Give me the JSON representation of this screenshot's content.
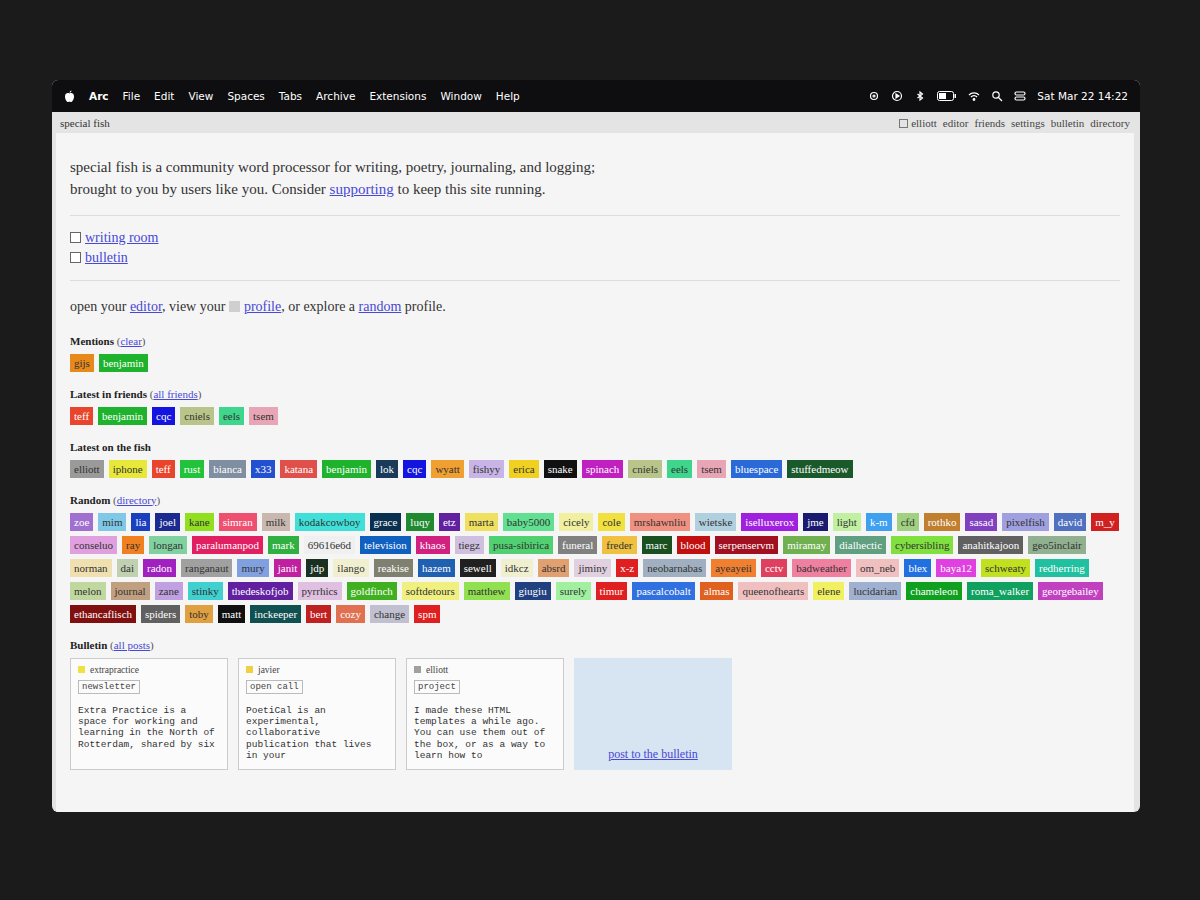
{
  "menubar": {
    "app": "Arc",
    "items": [
      "File",
      "Edit",
      "View",
      "Spaces",
      "Tabs",
      "Archive",
      "Extensions",
      "Window",
      "Help"
    ],
    "clock": "Sat Mar 22 14:22"
  },
  "tab": {
    "title": "special fish"
  },
  "nav": {
    "items": [
      "elliott",
      "editor",
      "friends",
      "settings",
      "bulletin",
      "directory"
    ]
  },
  "intro": {
    "line1": "special fish is a community word processor for writing, poetry, journaling, and logging;",
    "line2_before": "brought to you by users like you. Consider ",
    "line2_link": "supporting",
    "line2_after": " to keep this site running."
  },
  "rooms": [
    {
      "label": "writing room"
    },
    {
      "label": "bulletin"
    }
  ],
  "open_line": [
    {
      "text": "open your ",
      "link": false
    },
    {
      "text": "editor",
      "link": true
    },
    {
      "text": ", view your ",
      "link": false
    },
    {
      "text": "profile",
      "link": true,
      "box": true
    },
    {
      "text": ", or explore a ",
      "link": false
    },
    {
      "text": "random",
      "link": true
    },
    {
      "text": " profile.",
      "link": false
    }
  ],
  "brackets": [
    "(",
    ")"
  ],
  "sections": [
    {
      "title": "Mentions",
      "action": "clear",
      "tags": [
        {
          "name": "gijs",
          "color": "#e8891c"
        },
        {
          "name": "benjamin",
          "color": "#1fb32d"
        }
      ]
    },
    {
      "title": "Latest in friends",
      "action": "all friends",
      "tags": [
        {
          "name": "teff",
          "color": "#e8452c"
        },
        {
          "name": "benjamin",
          "color": "#1fb32d"
        },
        {
          "name": "cqc",
          "color": "#1414e0"
        },
        {
          "name": "cniels",
          "color": "#b9c48a"
        },
        {
          "name": "eels",
          "color": "#3dd68c"
        },
        {
          "name": "tsem",
          "color": "#e8a5b5"
        }
      ]
    },
    {
      "title": "Latest on the fish",
      "action": "",
      "tags": [
        {
          "name": "elliott",
          "color": "#9a9a9a"
        },
        {
          "name": "iphone",
          "color": "#e8e83a"
        },
        {
          "name": "teff",
          "color": "#e8452c"
        },
        {
          "name": "rust",
          "color": "#22c23a"
        },
        {
          "name": "bianca",
          "color": "#7f8ea0"
        },
        {
          "name": "x33",
          "color": "#2250d0"
        },
        {
          "name": "katana",
          "color": "#e0504a"
        },
        {
          "name": "benjamin",
          "color": "#1fb32d"
        },
        {
          "name": "lok",
          "color": "#1a3a5a"
        },
        {
          "name": "cqc",
          "color": "#1414e0"
        },
        {
          "name": "wyatt",
          "color": "#f0a030"
        },
        {
          "name": "fishyy",
          "color": "#c8b4e6"
        },
        {
          "name": "erica",
          "color": "#f0d020"
        },
        {
          "name": "snake",
          "color": "#111111"
        },
        {
          "name": "spinach",
          "color": "#c020c0"
        },
        {
          "name": "cniels",
          "color": "#b9c48a"
        },
        {
          "name": "eels",
          "color": "#3dd68c"
        },
        {
          "name": "tsem",
          "color": "#e8a5b5"
        },
        {
          "name": "bluespace",
          "color": "#2a6ad8"
        },
        {
          "name": "stuffedmeow",
          "color": "#1a5a2a"
        }
      ]
    },
    {
      "title": "Random",
      "action": "directory",
      "tags": [
        {
          "name": "zoe",
          "color": "#a070d0"
        },
        {
          "name": "mim",
          "color": "#80c8e8"
        },
        {
          "name": "lia",
          "color": "#1a40c0"
        },
        {
          "name": "joel",
          "color": "#1a2a90"
        },
        {
          "name": "kane",
          "color": "#90e020"
        },
        {
          "name": "simran",
          "color": "#f05070"
        },
        {
          "name": "milk",
          "color": "#c8b8b0"
        },
        {
          "name": "kodakcowboy",
          "color": "#40e0d8"
        },
        {
          "name": "grace",
          "color": "#0a3050"
        },
        {
          "name": "luqy",
          "color": "#208a30"
        },
        {
          "name": "etz",
          "color": "#6020a0"
        },
        {
          "name": "marta",
          "color": "#f0e060"
        },
        {
          "name": "baby5000",
          "color": "#60e090"
        },
        {
          "name": "cicely",
          "color": "#f0f0a0"
        },
        {
          "name": "cole",
          "color": "#f0e040"
        },
        {
          "name": "mrshawnliu",
          "color": "#f09080"
        },
        {
          "name": "wietske",
          "color": "#b0d0e0"
        },
        {
          "name": "iselluxerox",
          "color": "#a020e0"
        },
        {
          "name": "jme",
          "color": "#1a1a70"
        },
        {
          "name": "light",
          "color": "#c0f0a0"
        },
        {
          "name": "k-m",
          "color": "#40a0f0"
        },
        {
          "name": "cfd",
          "color": "#a0d080"
        },
        {
          "name": "rothko",
          "color": "#c08030"
        },
        {
          "name": "sasad",
          "color": "#8040c0"
        },
        {
          "name": "pixelfish",
          "color": "#a0a0e0"
        },
        {
          "name": "david",
          "color": "#5070c0"
        },
        {
          "name": "m_y",
          "color": "#d02020"
        },
        {
          "name": "conseluo",
          "color": "#e0a0e0"
        },
        {
          "name": "ray",
          "color": "#f08020"
        },
        {
          "name": "longan",
          "color": "#80d0a0"
        },
        {
          "name": "paralumanpod",
          "color": "#e02060"
        },
        {
          "name": "mark",
          "color": "#30b040"
        },
        {
          "name": "69616e6d",
          "color": "#f0f0f0"
        },
        {
          "name": "television",
          "color": "#1060c0"
        },
        {
          "name": "khaos",
          "color": "#d02080"
        },
        {
          "name": "tiegz",
          "color": "#d0c0e0"
        },
        {
          "name": "pusa-sibirica",
          "color": "#50d070"
        },
        {
          "name": "funeral",
          "color": "#808080"
        },
        {
          "name": "freder",
          "color": "#f0c040"
        },
        {
          "name": "marc",
          "color": "#1a5020"
        },
        {
          "name": "blood",
          "color": "#c01010"
        },
        {
          "name": "serpenservm",
          "color": "#a01020"
        },
        {
          "name": "miramay",
          "color": "#70b050"
        },
        {
          "name": "dialhectic",
          "color": "#60a080"
        },
        {
          "name": "cybersibling",
          "color": "#80e040"
        },
        {
          "name": "anahitkajoon",
          "color": "#606060"
        },
        {
          "name": "geo5inclair",
          "color": "#90b090"
        },
        {
          "name": "norman",
          "color": "#f0e0b0"
        },
        {
          "name": "dai",
          "color": "#c0d0b0"
        },
        {
          "name": "radon",
          "color": "#a020c0"
        },
        {
          "name": "ranganaut",
          "color": "#a0a0a0"
        },
        {
          "name": "mury",
          "color": "#80a0e0"
        },
        {
          "name": "janit",
          "color": "#c020a0"
        },
        {
          "name": "jdp",
          "color": "#1a3020"
        },
        {
          "name": "ilango",
          "color": "#f0f0d0"
        },
        {
          "name": "reakise",
          "color": "#808070"
        },
        {
          "name": "hazem",
          "color": "#2060b0"
        },
        {
          "name": "sewell",
          "color": "#202020"
        },
        {
          "name": "idkcz",
          "color": "#f0f0d0"
        },
        {
          "name": "absrd",
          "color": "#e0a070"
        },
        {
          "name": "jiminy",
          "color": "#e0d0e0"
        },
        {
          "name": "x-z",
          "color": "#e02020"
        },
        {
          "name": "neobarnabas",
          "color": "#a0b0c0"
        },
        {
          "name": "ayeayeii",
          "color": "#f08030"
        },
        {
          "name": "cctv",
          "color": "#e04060"
        },
        {
          "name": "badweather",
          "color": "#f080a0"
        },
        {
          "name": "om_neb",
          "color": "#f0c0c0"
        },
        {
          "name": "blex",
          "color": "#2070e0"
        },
        {
          "name": "baya12",
          "color": "#e040e0"
        },
        {
          "name": "schweaty",
          "color": "#c0e020"
        },
        {
          "name": "redherring",
          "color": "#20c0a0"
        },
        {
          "name": "melon",
          "color": "#c0d8a0"
        },
        {
          "name": "journal",
          "color": "#c0a080"
        },
        {
          "name": "zane",
          "color": "#c0a0e0"
        },
        {
          "name": "stinky",
          "color": "#40d0d0"
        },
        {
          "name": "thedeskofjob",
          "color": "#6020a0"
        },
        {
          "name": "pyrrhics",
          "color": "#e0c0e0"
        },
        {
          "name": "goldfinch",
          "color": "#40b020"
        },
        {
          "name": "softdetours",
          "color": "#f0f080"
        },
        {
          "name": "matthew",
          "color": "#90e050"
        },
        {
          "name": "giugiu",
          "color": "#204080"
        },
        {
          "name": "surely",
          "color": "#a0f0a0"
        },
        {
          "name": "timur",
          "color": "#e02020"
        },
        {
          "name": "pascalcobalt",
          "color": "#3070e0"
        },
        {
          "name": "almas",
          "color": "#e06020"
        },
        {
          "name": "queenofhearts",
          "color": "#f0c0c0"
        },
        {
          "name": "elene",
          "color": "#f0f060"
        },
        {
          "name": "lucidarian",
          "color": "#a0b0d0"
        },
        {
          "name": "chameleon",
          "color": "#10a020"
        },
        {
          "name": "roma_walker",
          "color": "#10a060"
        },
        {
          "name": "georgebailey",
          "color": "#c040c0"
        },
        {
          "name": "ethancaflisch",
          "color": "#801010"
        },
        {
          "name": "spiders",
          "color": "#606060"
        },
        {
          "name": "toby",
          "color": "#e0a040"
        },
        {
          "name": "matt",
          "color": "#101010"
        },
        {
          "name": "inckeeper",
          "color": "#105050"
        },
        {
          "name": "bert",
          "color": "#c02020"
        },
        {
          "name": "cozy",
          "color": "#e07050"
        },
        {
          "name": "change",
          "color": "#c0c0d0"
        },
        {
          "name": "spm",
          "color": "#e02020"
        }
      ]
    }
  ],
  "bulletin": {
    "title": "Bulletin",
    "action": "all posts",
    "post_link": "post to the bulletin",
    "posts": [
      {
        "author": "extrapractice",
        "color": "#f0e040",
        "type": "newsletter",
        "body": "Extra Practice is a space for working and learning in the North of Rotterdam, shared by six"
      },
      {
        "author": "javier",
        "color": "#f0d040",
        "type": "open call",
        "body": "PoetiCal is an experimental, collaborative publication that lives in your"
      },
      {
        "author": "elliott",
        "color": "#a0a0a0",
        "type": "project",
        "body": "I made these HTML templates a while ago. You can use them out of the box, or as a way to learn how to"
      }
    ]
  }
}
